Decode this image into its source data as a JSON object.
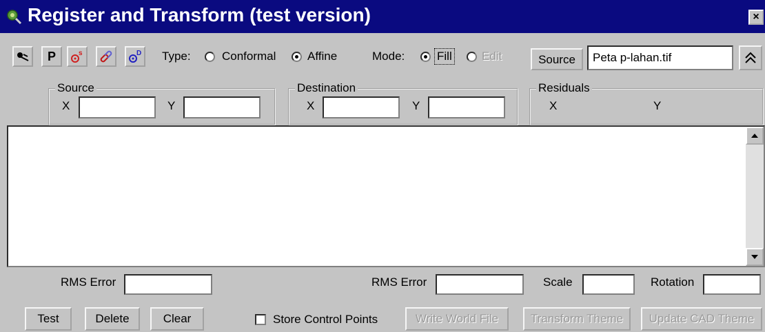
{
  "window": {
    "title": "Register and Transform (test version)",
    "close": "×"
  },
  "toolbar": {
    "p_label": "P"
  },
  "type": {
    "label": "Type:",
    "option_conformal": "Conformal",
    "option_affine": "Affine",
    "selected": "Affine"
  },
  "mode": {
    "label": "Mode:",
    "option_fill": "Fill",
    "option_edit": "Edit",
    "selected": "Fill"
  },
  "source_select": {
    "button_label": "Source",
    "file_value": "Peta p-lahan.tif"
  },
  "source_group": {
    "legend": "Source",
    "x_label": "X",
    "y_label": "Y"
  },
  "destination_group": {
    "legend": "Destination",
    "x_label": "X",
    "y_label": "Y"
  },
  "residuals_group": {
    "legend": "Residuals",
    "x_label": "X",
    "y_label": "Y"
  },
  "stats": {
    "rms_error_left": "RMS Error",
    "rms_error_right": "RMS Error",
    "scale": "Scale",
    "rotation": "Rotation"
  },
  "buttons": {
    "test": "Test",
    "delete": "Delete",
    "clear": "Clear",
    "store_control_points": "Store Control Points",
    "write_world_file": "Write World File",
    "transform_theme": "Transform Theme",
    "update_cad_theme": "Update CAD Theme"
  }
}
